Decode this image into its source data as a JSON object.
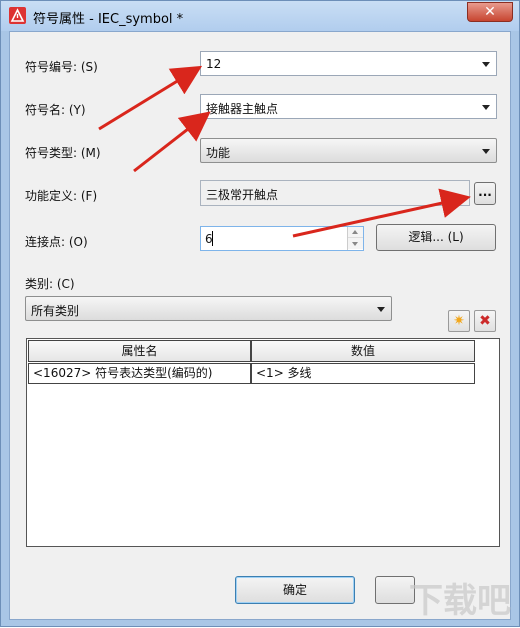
{
  "window": {
    "title": "符号属性 - IEC_symbol *",
    "close_label": "✕"
  },
  "form": {
    "symbol_number_label": "符号编号: (S)",
    "symbol_number_value": "12",
    "symbol_name_label": "符号名: (Y)",
    "symbol_name_value": "接触器主触点",
    "symbol_type_label": "符号类型: (M)",
    "symbol_type_value": "功能",
    "function_def_label": "功能定义: (F)",
    "function_def_value": "三极常开触点",
    "browse_label": "...",
    "connection_label": "连接点: (O)",
    "connection_value": "6",
    "logic_button_label": "逻辑... (L)",
    "category_label": "类别: (C)",
    "category_value": "所有类别"
  },
  "table": {
    "headers": [
      "属性名",
      "数值"
    ],
    "rows": [
      [
        "<16027> 符号表达类型(编码的)",
        "<1> 多线"
      ]
    ]
  },
  "footer": {
    "ok_label": "确定"
  },
  "colors": {
    "annotation_arrow": "#d9261c",
    "star_icon": "#f2a71b",
    "delete_icon": "#cc2a2a"
  },
  "watermark": {
    "text": "下载吧"
  }
}
